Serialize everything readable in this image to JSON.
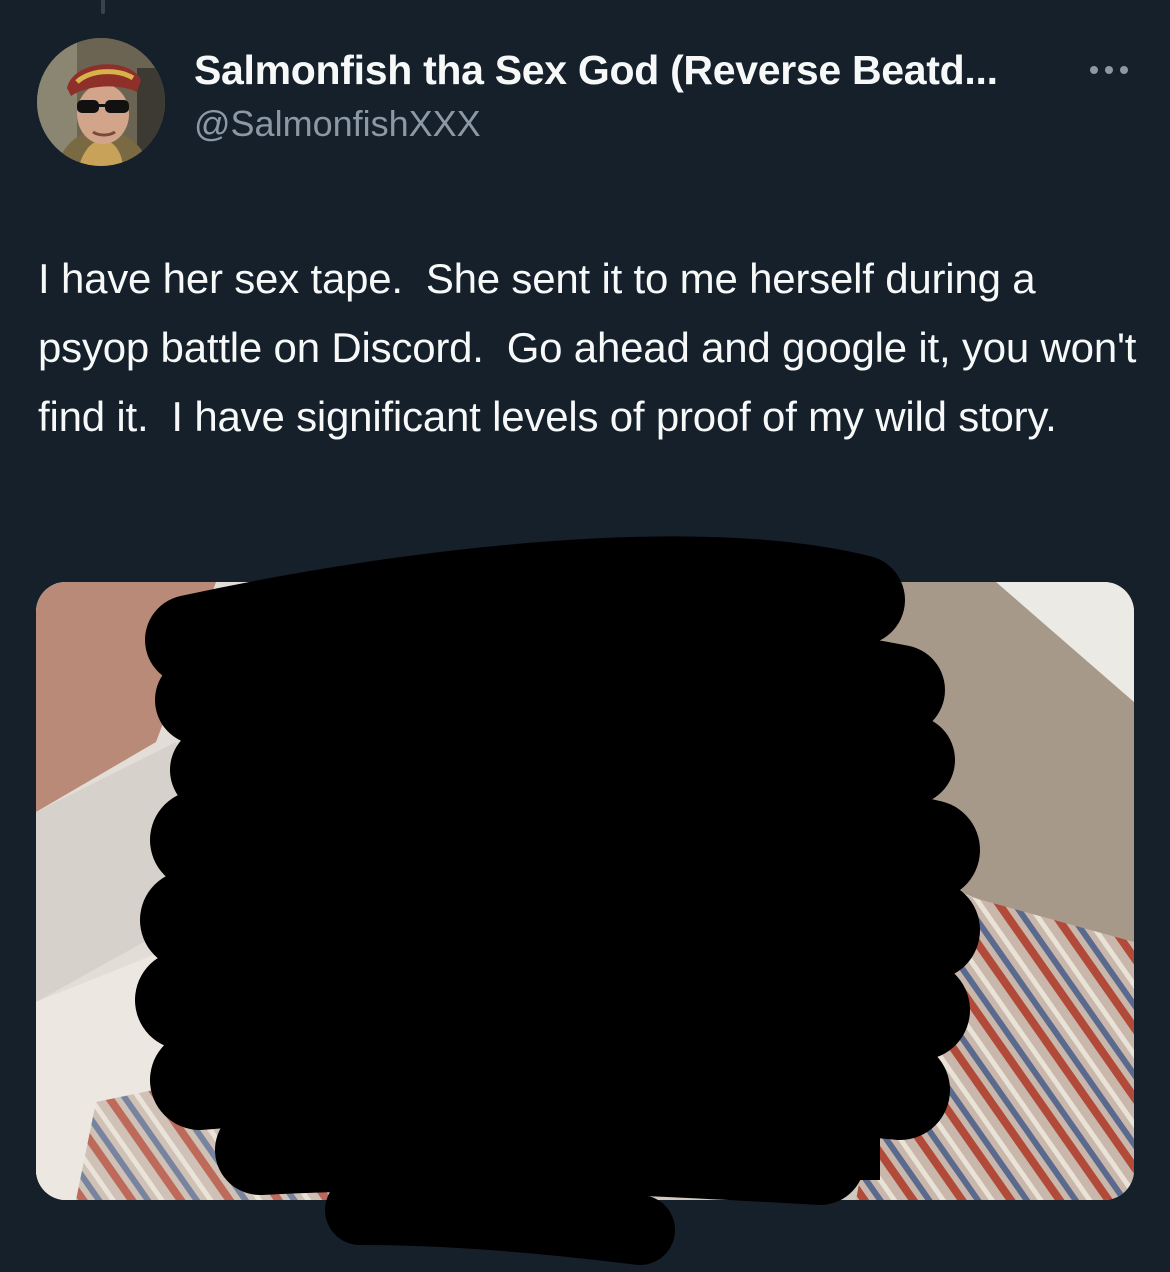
{
  "tweet": {
    "author": {
      "display_name": "Salmonfish tha Sex God (Reverse Beatd...",
      "handle": "@SalmonfishXXX",
      "avatar_icon": "user-photo-avatar"
    },
    "more_icon": "more-horizontal-icon",
    "text": "I have her sex tape.  She sent it to me herself during a psyop battle on Discord.  Go ahead and google it, you won't find it.  I have significant levels of proof of my wild story.",
    "media": {
      "type": "photo",
      "redacted": true,
      "redaction_color": "#000000"
    }
  },
  "theme": {
    "background": "#15202b",
    "primary_text": "#f7f9f9",
    "secondary_text": "#8b98a5"
  }
}
